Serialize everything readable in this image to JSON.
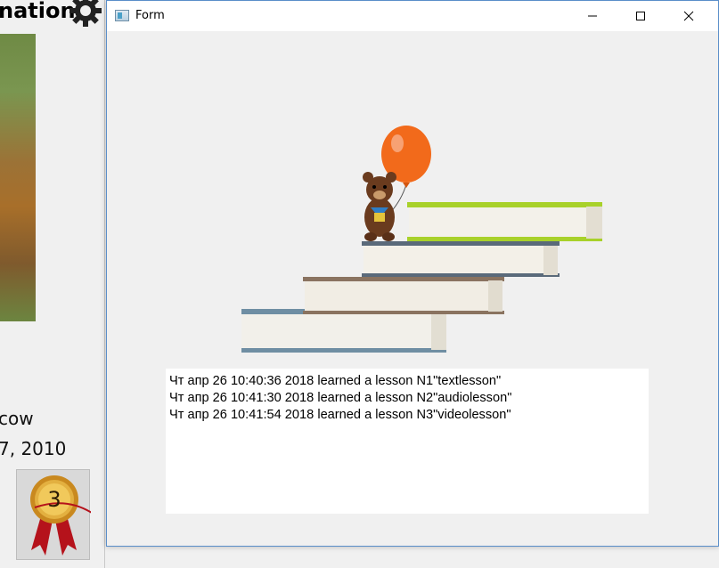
{
  "background_app": {
    "title_partial": "nation",
    "city_partial": "cow",
    "date_partial": "7, 2010",
    "medal_number": "3"
  },
  "window": {
    "title": "Form",
    "buttons": {
      "minimize": "—",
      "maximize": "☐",
      "close": "✕"
    },
    "log_lines": [
      "Чт апр 26 10:40:36 2018 learned a lesson N1\"textlesson\"",
      "Чт апр 26 10:41:30 2018 learned a lesson N2\"audiolesson\"",
      "Чт апр 26 10:41:54 2018 learned a lesson N3\"videolesson\""
    ]
  },
  "colors": {
    "accent_border": "#5a8ec9",
    "balloon": "#f26a1b",
    "window_bg": "#f0f0f0"
  }
}
